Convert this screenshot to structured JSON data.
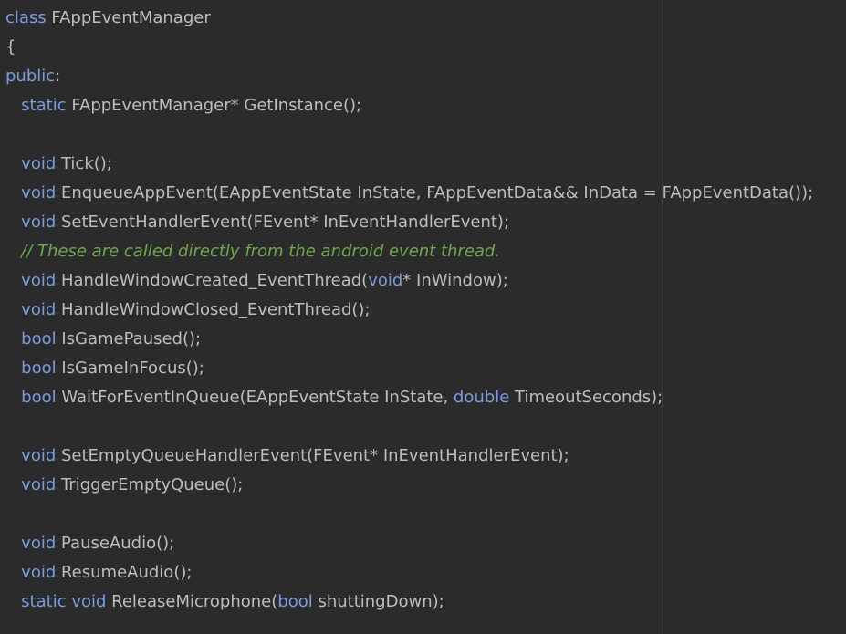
{
  "theme": {
    "background": "#2b2b2b",
    "text": "#bdbdbd",
    "keyword": "#7a9be0",
    "comment": "#6fa84f"
  },
  "lines": [
    {
      "tokens": [
        {
          "type": "keyword",
          "text": "class"
        },
        {
          "type": "text",
          "text": " FAppEventManager"
        }
      ]
    },
    {
      "tokens": [
        {
          "type": "text",
          "text": "{"
        }
      ]
    },
    {
      "tokens": [
        {
          "type": "keyword",
          "text": "public"
        },
        {
          "type": "text",
          "text": ":"
        }
      ]
    },
    {
      "tokens": [
        {
          "type": "text",
          "text": "   "
        },
        {
          "type": "keyword",
          "text": "static"
        },
        {
          "type": "text",
          "text": " FAppEventManager* GetInstance();"
        }
      ]
    },
    {
      "tokens": []
    },
    {
      "tokens": [
        {
          "type": "text",
          "text": "   "
        },
        {
          "type": "keyword",
          "text": "void"
        },
        {
          "type": "text",
          "text": " Tick();"
        }
      ]
    },
    {
      "tokens": [
        {
          "type": "text",
          "text": "   "
        },
        {
          "type": "keyword",
          "text": "void"
        },
        {
          "type": "text",
          "text": " EnqueueAppEvent(EAppEventState InState, FAppEventData&& InData = FAppEventData());"
        }
      ]
    },
    {
      "tokens": [
        {
          "type": "text",
          "text": "   "
        },
        {
          "type": "keyword",
          "text": "void"
        },
        {
          "type": "text",
          "text": " SetEventHandlerEvent(FEvent* InEventHandlerEvent);"
        }
      ]
    },
    {
      "tokens": [
        {
          "type": "text",
          "text": "   "
        },
        {
          "type": "comment",
          "text": "// These are called directly from the android event thread."
        }
      ]
    },
    {
      "tokens": [
        {
          "type": "text",
          "text": "   "
        },
        {
          "type": "keyword",
          "text": "void"
        },
        {
          "type": "text",
          "text": " HandleWindowCreated_EventThread("
        },
        {
          "type": "keyword",
          "text": "void"
        },
        {
          "type": "text",
          "text": "* InWindow);"
        }
      ]
    },
    {
      "tokens": [
        {
          "type": "text",
          "text": "   "
        },
        {
          "type": "keyword",
          "text": "void"
        },
        {
          "type": "text",
          "text": " HandleWindowClosed_EventThread();"
        }
      ]
    },
    {
      "tokens": [
        {
          "type": "text",
          "text": "   "
        },
        {
          "type": "keyword",
          "text": "bool"
        },
        {
          "type": "text",
          "text": " IsGamePaused();"
        }
      ]
    },
    {
      "tokens": [
        {
          "type": "text",
          "text": "   "
        },
        {
          "type": "keyword",
          "text": "bool"
        },
        {
          "type": "text",
          "text": " IsGameInFocus();"
        }
      ]
    },
    {
      "tokens": [
        {
          "type": "text",
          "text": "   "
        },
        {
          "type": "keyword",
          "text": "bool"
        },
        {
          "type": "text",
          "text": " WaitForEventInQueue(EAppEventState InState, "
        },
        {
          "type": "keyword",
          "text": "double"
        },
        {
          "type": "text",
          "text": " TimeoutSeconds);"
        }
      ]
    },
    {
      "tokens": []
    },
    {
      "tokens": [
        {
          "type": "text",
          "text": "   "
        },
        {
          "type": "keyword",
          "text": "void"
        },
        {
          "type": "text",
          "text": " SetEmptyQueueHandlerEvent(FEvent* InEventHandlerEvent);"
        }
      ]
    },
    {
      "tokens": [
        {
          "type": "text",
          "text": "   "
        },
        {
          "type": "keyword",
          "text": "void"
        },
        {
          "type": "text",
          "text": " TriggerEmptyQueue();"
        }
      ]
    },
    {
      "tokens": []
    },
    {
      "tokens": [
        {
          "type": "text",
          "text": "   "
        },
        {
          "type": "keyword",
          "text": "void"
        },
        {
          "type": "text",
          "text": " PauseAudio();"
        }
      ]
    },
    {
      "tokens": [
        {
          "type": "text",
          "text": "   "
        },
        {
          "type": "keyword",
          "text": "void"
        },
        {
          "type": "text",
          "text": " ResumeAudio();"
        }
      ]
    },
    {
      "tokens": [
        {
          "type": "text",
          "text": "   "
        },
        {
          "type": "keyword",
          "text": "static"
        },
        {
          "type": "text",
          "text": " "
        },
        {
          "type": "keyword",
          "text": "void"
        },
        {
          "type": "text",
          "text": " ReleaseMicrophone("
        },
        {
          "type": "keyword",
          "text": "bool"
        },
        {
          "type": "text",
          "text": " shuttingDown);"
        }
      ]
    }
  ]
}
